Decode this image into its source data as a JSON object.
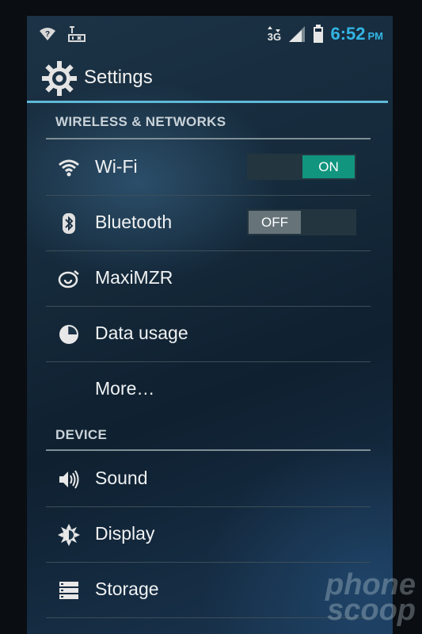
{
  "status_bar": {
    "network_type": "3G",
    "time": "6:52",
    "ampm": "PM"
  },
  "title_bar": {
    "title": "Settings"
  },
  "sections": {
    "wireless": "WIRELESS & NETWORKS",
    "device": "DEVICE"
  },
  "items": {
    "wifi": {
      "label": "Wi-Fi",
      "toggle": "ON"
    },
    "bluetooth": {
      "label": "Bluetooth",
      "toggle": "OFF"
    },
    "maximzr": {
      "label": "MaxiMZR"
    },
    "data_usage": {
      "label": "Data usage"
    },
    "more": {
      "label": "More…"
    },
    "sound": {
      "label": "Sound"
    },
    "display": {
      "label": "Display"
    },
    "storage": {
      "label": "Storage"
    }
  },
  "watermark": {
    "line1": "phone",
    "line2": "scoop"
  },
  "colors": {
    "accent": "#33b5e5",
    "toggle_on": "#11957f",
    "toggle_off": "#667479"
  }
}
